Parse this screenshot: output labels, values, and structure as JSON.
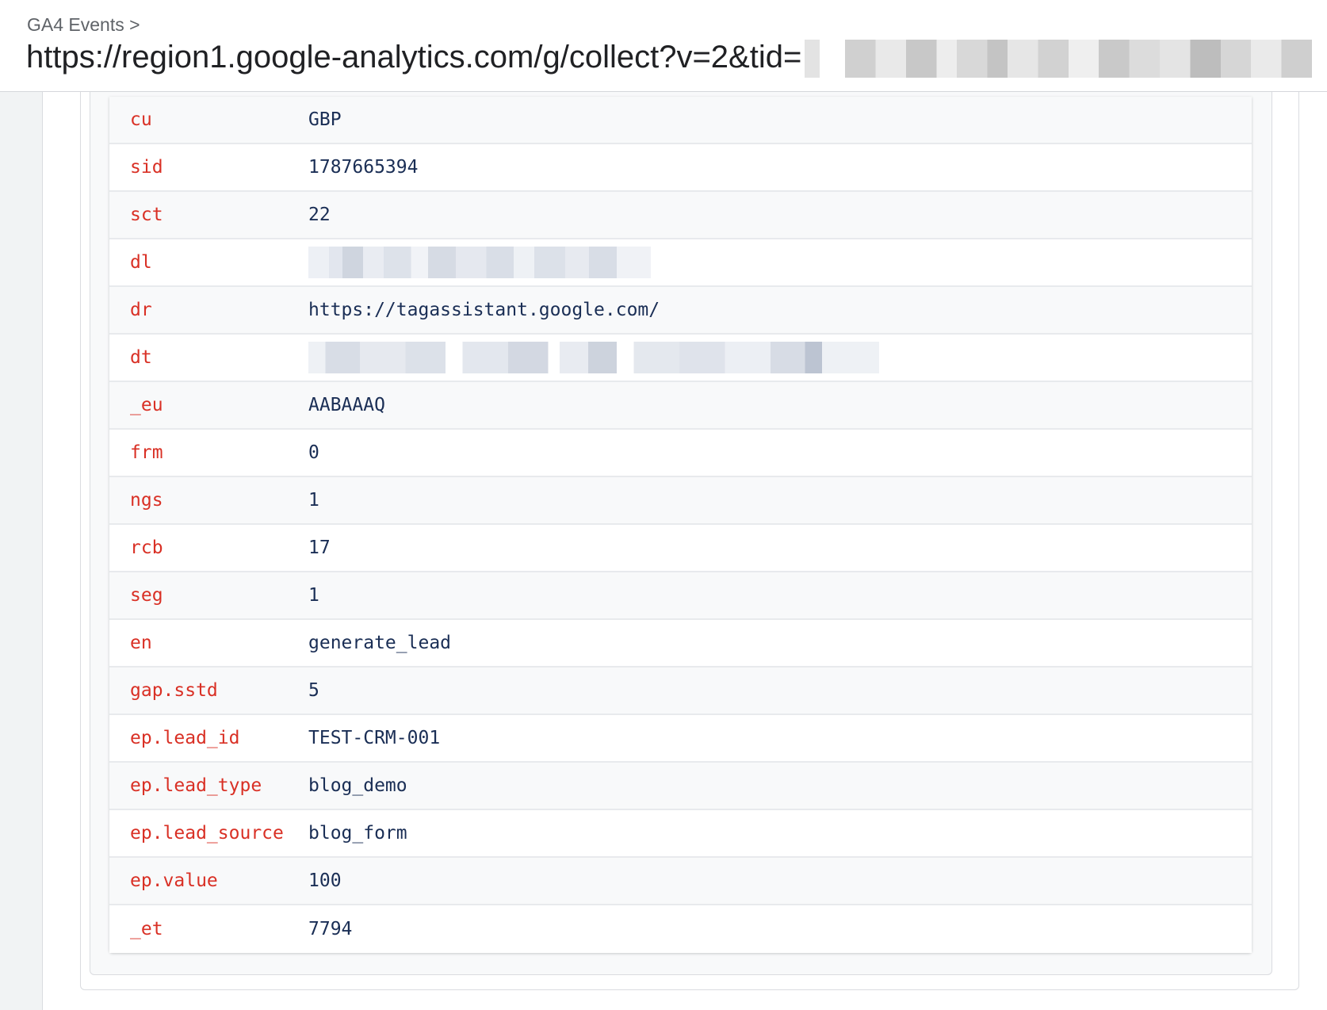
{
  "header": {
    "breadcrumb": "GA4 Events >",
    "url": "https://region1.google-analytics.com/g/collect?v=2&tid="
  },
  "params": [
    {
      "key": "cu",
      "value": "GBP"
    },
    {
      "key": "sid",
      "value": "1787665394"
    },
    {
      "key": "sct",
      "value": "22"
    },
    {
      "key": "dl",
      "value": null
    },
    {
      "key": "dr",
      "value": "https://tagassistant.google.com/"
    },
    {
      "key": "dt",
      "value": null
    },
    {
      "key": "_eu",
      "value": "AABAAAQ"
    },
    {
      "key": "frm",
      "value": "0"
    },
    {
      "key": "ngs",
      "value": "1"
    },
    {
      "key": "rcb",
      "value": "17"
    },
    {
      "key": "seg",
      "value": "1"
    },
    {
      "key": "en",
      "value": "generate_lead"
    },
    {
      "key": "gap.sstd",
      "value": "5"
    },
    {
      "key": "ep.lead_id",
      "value": "TEST-CRM-001"
    },
    {
      "key": "ep.lead_type",
      "value": "blog_demo"
    },
    {
      "key": "ep.lead_source",
      "value": "blog_form"
    },
    {
      "key": "ep.value",
      "value": "100"
    },
    {
      "key": "_et",
      "value": "7794"
    }
  ]
}
